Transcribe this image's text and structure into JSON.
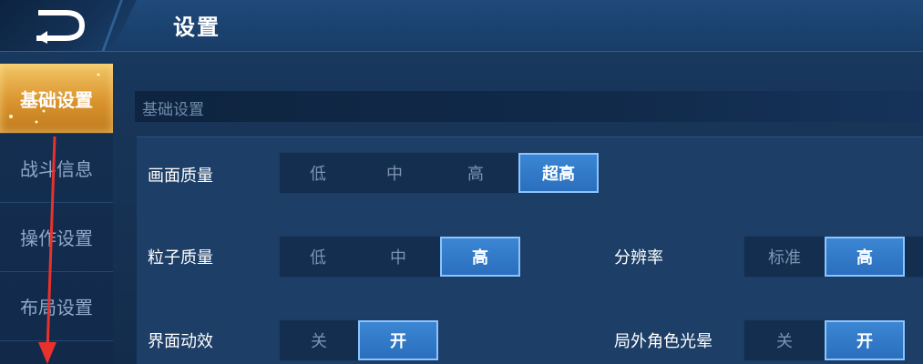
{
  "header": {
    "title": "设置",
    "back_icon": "back-arrow-icon"
  },
  "sidebar": {
    "items": [
      {
        "label": "基础设置",
        "active": true
      },
      {
        "label": "战斗信息",
        "active": false
      },
      {
        "label": "操作设置",
        "active": false
      },
      {
        "label": "布局设置",
        "active": false
      }
    ]
  },
  "section": {
    "title": "基础设置"
  },
  "settings": {
    "quality": {
      "label": "画面质量",
      "options": [
        "低",
        "中",
        "高",
        "超高"
      ],
      "selected": "超高"
    },
    "particle": {
      "label": "粒子质量",
      "options": [
        "低",
        "中",
        "高"
      ],
      "selected": "高"
    },
    "resolution": {
      "label": "分辨率",
      "options": [
        "标准",
        "高"
      ],
      "selected": "高"
    },
    "ui_effects": {
      "label": "界面动效",
      "options": [
        "关",
        "开"
      ],
      "selected": "开"
    },
    "halo": {
      "label": "局外角色光晕",
      "options": [
        "关",
        "开"
      ],
      "selected": "开"
    }
  },
  "colors": {
    "accent_blue": "#2a6fbd",
    "active_gold": "#d9942e",
    "annotation_red": "#e8322c"
  }
}
